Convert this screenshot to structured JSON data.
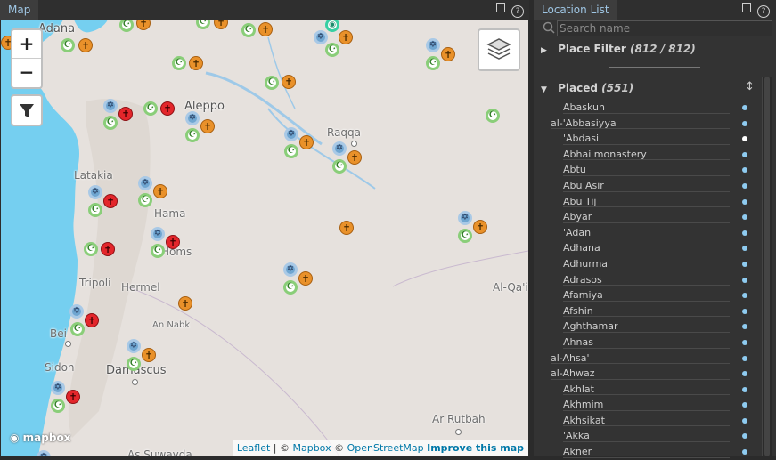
{
  "map_panel": {
    "tab_label": "Map",
    "help_glyph": "?",
    "zoom_in": "+",
    "zoom_out": "−",
    "mapbox_logo": "mapbox",
    "attribution": {
      "leaflet": "Leaflet",
      "sep1": " | © ",
      "mapbox": "Mapbox",
      "sep2": " © ",
      "osm": "OpenStreetMap",
      "improve": "Improve this map"
    },
    "places": {
      "adana": "Adana",
      "aleppo": "Aleppo",
      "raqqa": "Raqqa",
      "latakia": "Latakia",
      "hama": "Hama",
      "homs": "Homs",
      "tripoli": "Tripoli",
      "hermel": "Hermel",
      "an_nabk": "An Nabk",
      "beirut": "Bei",
      "sidon": "Sidon",
      "damascus": "Damascus",
      "al_qaim": "Al-Qa'i",
      "ar_rutbah": "Ar Rutbah",
      "as_suwayda": "As Suwayda"
    },
    "marker_glyphs": {
      "islam": "☪",
      "christian": "✝",
      "jewish": "✡",
      "other": "◉"
    }
  },
  "list_panel": {
    "tab_label": "Location List",
    "help_glyph": "?",
    "search_placeholder": "Search name",
    "place_filter": {
      "label": "Place Filter",
      "count": "(812 / 812)",
      "arrow": "▶"
    },
    "placed": {
      "label": "Placed",
      "count": "(551)",
      "arrow": "▼",
      "sort_glyph": "↕"
    },
    "items": [
      {
        "label": "Abaskun",
        "indent": 2
      },
      {
        "label": "al-'Abbasiyya",
        "indent": 1
      },
      {
        "label": "'Abdasi",
        "indent": 2
      },
      {
        "label": "Abhai monastery",
        "indent": 2
      },
      {
        "label": "Abtu",
        "indent": 2
      },
      {
        "label": "Abu Asir",
        "indent": 2
      },
      {
        "label": "Abu Tij",
        "indent": 2
      },
      {
        "label": "Abyar",
        "indent": 2
      },
      {
        "label": "'Adan",
        "indent": 2
      },
      {
        "label": "Adhana",
        "indent": 2
      },
      {
        "label": "Adhurma",
        "indent": 2
      },
      {
        "label": "Adrasos",
        "indent": 2
      },
      {
        "label": "Afamiya",
        "indent": 2
      },
      {
        "label": "Afshin",
        "indent": 2
      },
      {
        "label": "Aghthamar",
        "indent": 2
      },
      {
        "label": "Ahnas",
        "indent": 2
      },
      {
        "label": "al-Ahsa'",
        "indent": 1
      },
      {
        "label": "al-Ahwaz",
        "indent": 1
      },
      {
        "label": "Akhlat",
        "indent": 2
      },
      {
        "label": "Akhmim",
        "indent": 2
      },
      {
        "label": "Akhsikat",
        "indent": 2
      },
      {
        "label": "'Akka",
        "indent": 2
      },
      {
        "label": "Akner",
        "indent": 2
      }
    ]
  },
  "colors": {
    "islam": "#8ace79",
    "christian": "#e9912a",
    "christian_red": "#e3262b",
    "jewish": "#6fa6d1",
    "other": "#38cfa3",
    "tab_text": "#9fc6e4",
    "dot": "#8ecbf0"
  }
}
